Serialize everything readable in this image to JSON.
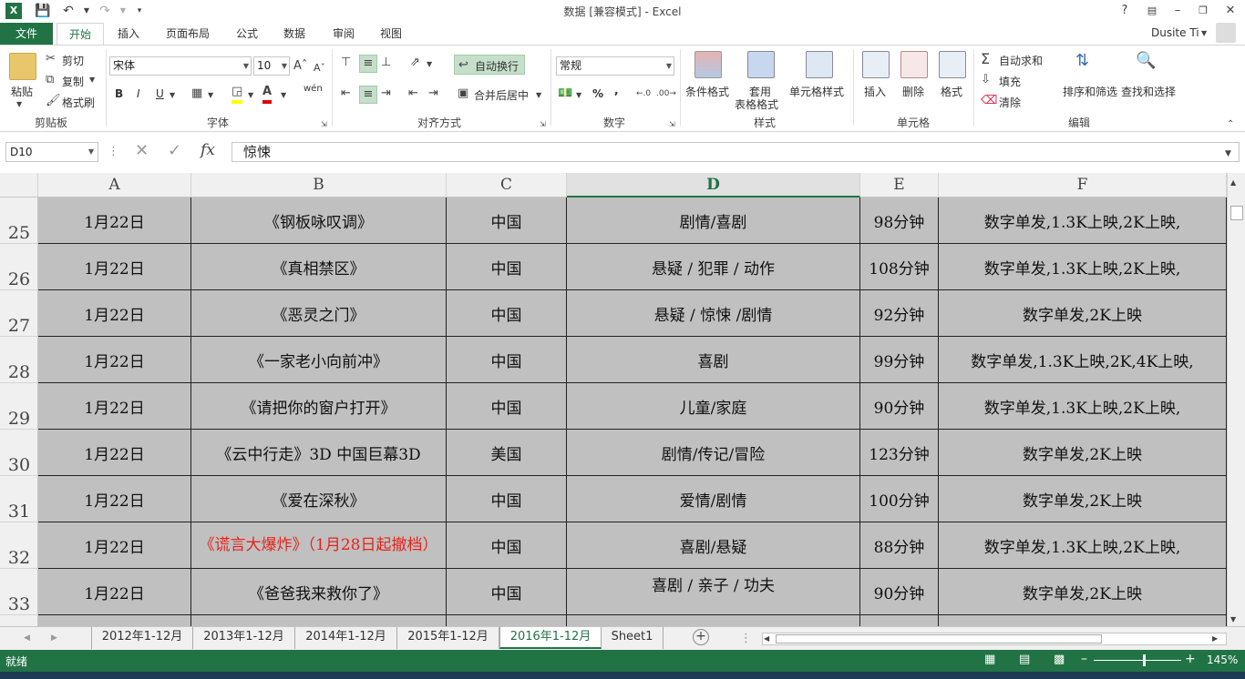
{
  "window": {
    "title": "数据  [兼容模式] - Excel",
    "user": "Dusite Ti",
    "help": "?"
  },
  "ribbon_tabs": [
    "文件",
    "开始",
    "插入",
    "页面布局",
    "公式",
    "数据",
    "审阅",
    "视图"
  ],
  "active_tab": "开始",
  "clipboard": {
    "paste": "粘贴",
    "cut": "剪切",
    "copy": "复制",
    "format_painter": "格式刷",
    "group": "剪贴板"
  },
  "font": {
    "name": "宋体",
    "size": "10",
    "bold": "B",
    "italic": "I",
    "underline": "U",
    "wen": "wén",
    "group": "字体"
  },
  "alignment": {
    "wrap_text": "自动换行",
    "merge_center": "合并后居中",
    "group": "对齐方式"
  },
  "number": {
    "format": "常规",
    "percent": "%",
    "comma": ",",
    "group": "数字"
  },
  "styles": {
    "conditional": "条件格式",
    "table_line1": "套用",
    "table_line2": "表格格式",
    "cell_styles": "单元格样式",
    "group": "样式"
  },
  "cells": {
    "insert": "插入",
    "delete": "删除",
    "format": "格式",
    "group": "单元格"
  },
  "editing": {
    "autosum": "自动求和",
    "fill": "填充",
    "clear": "清除",
    "sort_filter": "排序和筛选",
    "find_select": "查找和选择",
    "group": "编辑"
  },
  "formula_bar": {
    "name_box": "D10",
    "content": "惊悚",
    "fx": "fx"
  },
  "columns": [
    "A",
    "B",
    "C",
    "D",
    "E",
    "F"
  ],
  "selected_column": "D",
  "rows": [
    {
      "num": "25",
      "a": "1月22日",
      "b": "《钢板咏叹调》",
      "c": "中国",
      "d": "剧情/喜剧",
      "e": "98分钟",
      "f": "数字单发,1.3K上映,2K上映,"
    },
    {
      "num": "26",
      "a": "1月22日",
      "b": "《真相禁区》",
      "c": "中国",
      "d": "悬疑 / 犯罪 / 动作",
      "e": "108分钟",
      "f": "数字单发,1.3K上映,2K上映,"
    },
    {
      "num": "27",
      "a": "1月22日",
      "b": "《恶灵之门》",
      "c": "中国",
      "d": "悬疑 / 惊悚 /剧情",
      "e": "92分钟",
      "f": "数字单发,2K上映"
    },
    {
      "num": "28",
      "a": "1月22日",
      "b": "《一家老小向前冲》",
      "c": "中国",
      "d": "喜剧",
      "e": "99分钟",
      "f": "数字单发,1.3K上映,2K,4K上映,"
    },
    {
      "num": "29",
      "a": "1月22日",
      "b": "《请把你的窗户打开》",
      "c": "中国",
      "d": "儿童/家庭",
      "e": "90分钟",
      "f": "数字单发,1.3K上映,2K上映,"
    },
    {
      "num": "30",
      "a": "1月22日",
      "b": "《云中行走》3D 中国巨幕3D",
      "c": "美国",
      "d": "剧情/传记/冒险",
      "e": "123分钟",
      "f": "数字单发,2K上映"
    },
    {
      "num": "31",
      "a": "1月22日",
      "b": "《爱在深秋》",
      "c": "中国",
      "d": "爱情/剧情",
      "e": "100分钟",
      "f": "数字单发,2K上映"
    },
    {
      "num": "32",
      "a": "1月22日",
      "b": "《谎言大爆炸》（1月28日起撤档）",
      "c": "中国",
      "d": "喜剧/悬疑",
      "e": "88分钟",
      "f": "数字单发,1.3K上映,2K上映,"
    },
    {
      "num": "33",
      "a": "1月22日",
      "b": "《爸爸我来救你了》",
      "c": "中国",
      "d": "喜剧 / 亲子 / 功夫",
      "e": "90分钟",
      "f": "数字单发,2K上映"
    }
  ],
  "sheets": [
    "2012年1-12月",
    "2013年1-12月",
    "2014年1-12月",
    "2015年1-12月",
    "2016年1-12月",
    "Sheet1"
  ],
  "active_sheet": "2016年1-12月",
  "status": {
    "ready": "就绪",
    "zoom": "145%"
  },
  "colors": {
    "accent": "#217346",
    "cell_fill": "#c0c0c0",
    "red_text": "#e8231c"
  }
}
